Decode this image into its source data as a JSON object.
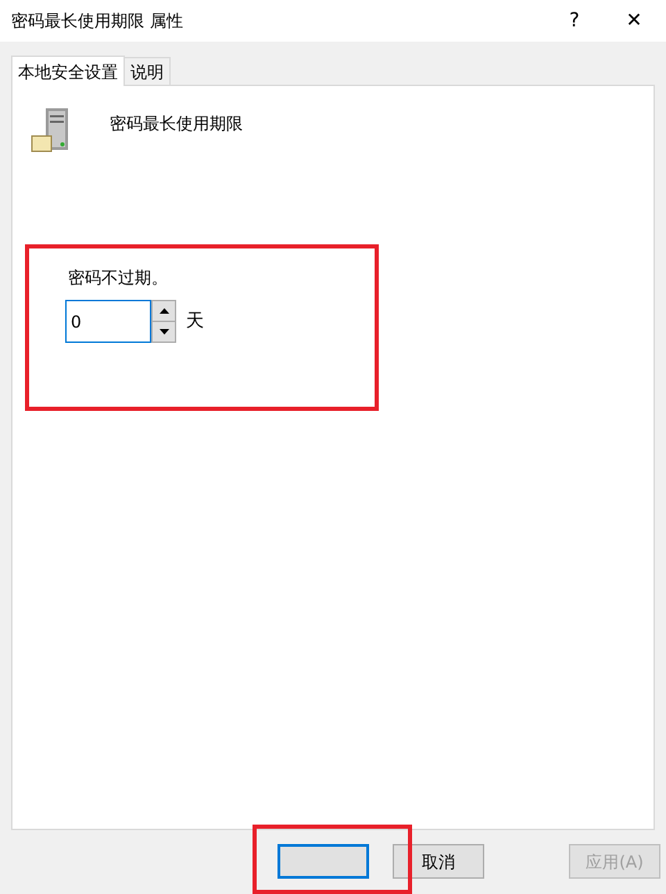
{
  "window": {
    "title": "密码最长使用期限 属性",
    "help": "?",
    "close": "✕"
  },
  "tabs": [
    {
      "label": "本地安全设置",
      "selected": true
    },
    {
      "label": "说明",
      "selected": false
    }
  ],
  "policy": {
    "name": "密码最长使用期限"
  },
  "setting": {
    "label": "密码不过期。",
    "value": "0",
    "unit": "天"
  },
  "buttons": [
    {
      "kind": "default",
      "disabled": false
    },
    {
      "kind": "normal",
      "label": "取消",
      "disabled": false
    },
    {
      "kind": "normal",
      "label": "应用(A)",
      "disabled": true
    }
  ]
}
